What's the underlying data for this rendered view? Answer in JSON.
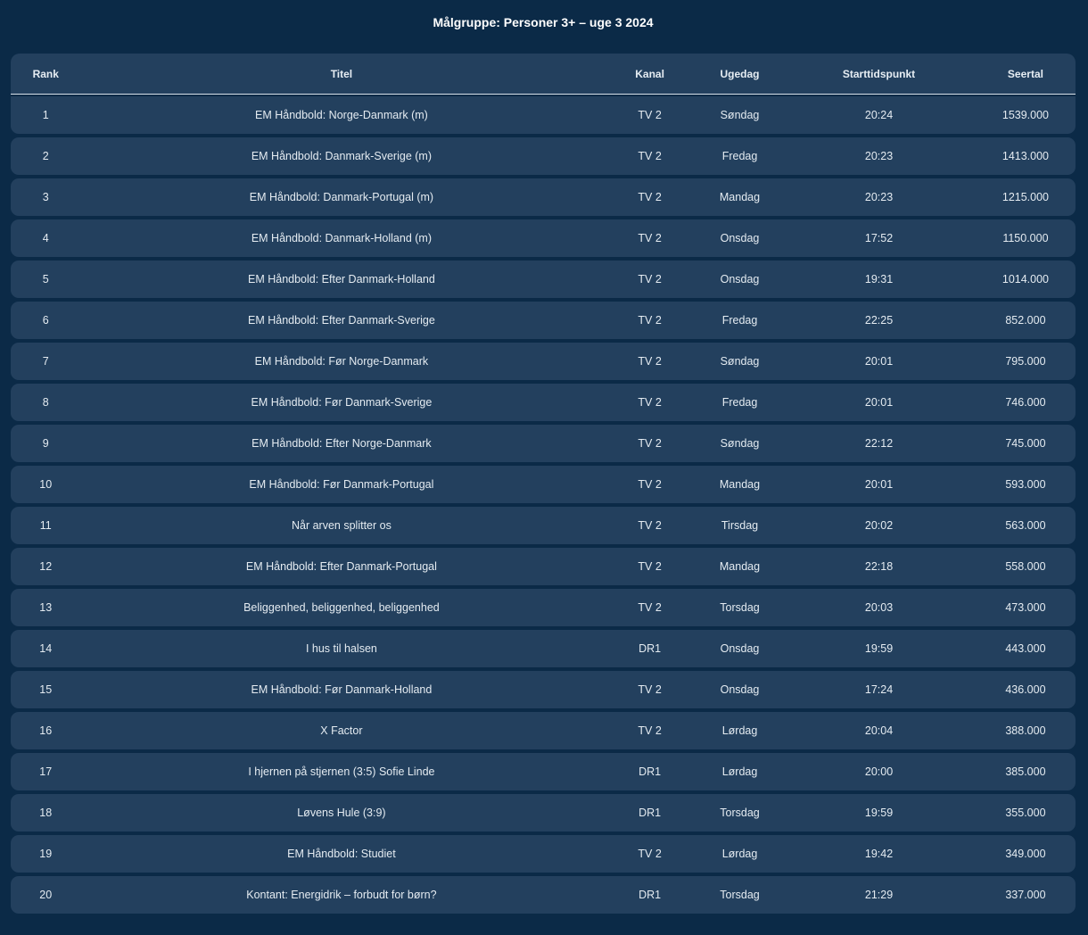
{
  "title": "Målgruppe: Personer 3+ – uge 3 2024",
  "columns": {
    "rank": "Rank",
    "title": "Titel",
    "channel": "Kanal",
    "day": "Ugedag",
    "time": "Starttidspunkt",
    "views": "Seertal"
  },
  "rows": [
    {
      "rank": "1",
      "title": "EM Håndbold: Norge-Danmark (m)",
      "channel": "TV 2",
      "day": "Søndag",
      "time": "20:24",
      "views": "1539.000"
    },
    {
      "rank": "2",
      "title": "EM Håndbold: Danmark-Sverige (m)",
      "channel": "TV 2",
      "day": "Fredag",
      "time": "20:23",
      "views": "1413.000"
    },
    {
      "rank": "3",
      "title": "EM Håndbold: Danmark-Portugal (m)",
      "channel": "TV 2",
      "day": "Mandag",
      "time": "20:23",
      "views": "1215.000"
    },
    {
      "rank": "4",
      "title": "EM Håndbold: Danmark-Holland (m)",
      "channel": "TV 2",
      "day": "Onsdag",
      "time": "17:52",
      "views": "1150.000"
    },
    {
      "rank": "5",
      "title": "EM Håndbold: Efter Danmark-Holland",
      "channel": "TV 2",
      "day": "Onsdag",
      "time": "19:31",
      "views": "1014.000"
    },
    {
      "rank": "6",
      "title": "EM Håndbold: Efter Danmark-Sverige",
      "channel": "TV 2",
      "day": "Fredag",
      "time": "22:25",
      "views": "852.000"
    },
    {
      "rank": "7",
      "title": "EM Håndbold: Før Norge-Danmark",
      "channel": "TV 2",
      "day": "Søndag",
      "time": "20:01",
      "views": "795.000"
    },
    {
      "rank": "8",
      "title": "EM Håndbold: Før Danmark-Sverige",
      "channel": "TV 2",
      "day": "Fredag",
      "time": "20:01",
      "views": "746.000"
    },
    {
      "rank": "9",
      "title": "EM Håndbold: Efter Norge-Danmark",
      "channel": "TV 2",
      "day": "Søndag",
      "time": "22:12",
      "views": "745.000"
    },
    {
      "rank": "10",
      "title": "EM Håndbold: Før Danmark-Portugal",
      "channel": "TV 2",
      "day": "Mandag",
      "time": "20:01",
      "views": "593.000"
    },
    {
      "rank": "11",
      "title": "Når arven splitter os",
      "channel": "TV 2",
      "day": "Tirsdag",
      "time": "20:02",
      "views": "563.000"
    },
    {
      "rank": "12",
      "title": "EM Håndbold: Efter Danmark-Portugal",
      "channel": "TV 2",
      "day": "Mandag",
      "time": "22:18",
      "views": "558.000"
    },
    {
      "rank": "13",
      "title": "Beliggenhed, beliggenhed, beliggenhed",
      "channel": "TV 2",
      "day": "Torsdag",
      "time": "20:03",
      "views": "473.000"
    },
    {
      "rank": "14",
      "title": "I hus til halsen",
      "channel": "DR1",
      "day": "Onsdag",
      "time": "19:59",
      "views": "443.000"
    },
    {
      "rank": "15",
      "title": "EM Håndbold: Før Danmark-Holland",
      "channel": "TV 2",
      "day": "Onsdag",
      "time": "17:24",
      "views": "436.000"
    },
    {
      "rank": "16",
      "title": "X Factor",
      "channel": "TV 2",
      "day": "Lørdag",
      "time": "20:04",
      "views": "388.000"
    },
    {
      "rank": "17",
      "title": "I hjernen på stjernen (3:5) Sofie Linde",
      "channel": "DR1",
      "day": "Lørdag",
      "time": "20:00",
      "views": "385.000"
    },
    {
      "rank": "18",
      "title": "Løvens Hule (3:9)",
      "channel": "DR1",
      "day": "Torsdag",
      "time": "19:59",
      "views": "355.000"
    },
    {
      "rank": "19",
      "title": "EM Håndbold: Studiet",
      "channel": "TV 2",
      "day": "Lørdag",
      "time": "19:42",
      "views": "349.000"
    },
    {
      "rank": "20",
      "title": "Kontant: Energidrik – forbudt for børn?",
      "channel": "DR1",
      "day": "Torsdag",
      "time": "21:29",
      "views": "337.000"
    }
  ]
}
